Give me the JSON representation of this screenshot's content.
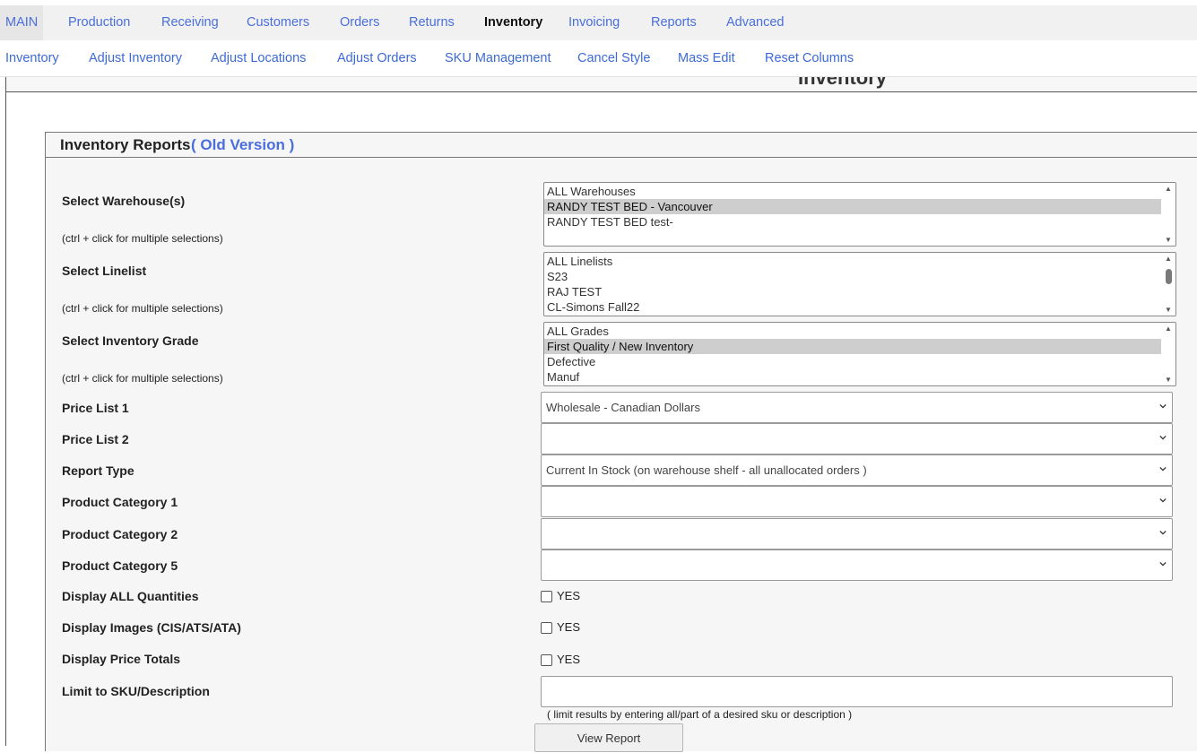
{
  "top_nav": {
    "items": [
      {
        "label": "MAIN"
      },
      {
        "label": "Production"
      },
      {
        "label": "Receiving"
      },
      {
        "label": "Customers"
      },
      {
        "label": "Orders"
      },
      {
        "label": "Returns"
      },
      {
        "label": "Inventory"
      },
      {
        "label": "Invoicing"
      },
      {
        "label": "Reports"
      },
      {
        "label": "Advanced"
      }
    ],
    "active": "Inventory"
  },
  "sub_nav": {
    "items": [
      {
        "label": "Inventory"
      },
      {
        "label": "Adjust Inventory"
      },
      {
        "label": "Adjust Locations"
      },
      {
        "label": "Adjust Orders"
      },
      {
        "label": "SKU Management"
      },
      {
        "label": "Cancel Style"
      },
      {
        "label": "Mass Edit"
      },
      {
        "label": "Reset Columns"
      }
    ]
  },
  "page": {
    "title": "Inventory"
  },
  "panel": {
    "title": "Inventory Reports",
    "link": "( Old Version )"
  },
  "form": {
    "warehouse": {
      "label": "Select Warehouse(s)",
      "hint": "(ctrl + click for multiple selections)",
      "options": [
        "ALL Warehouses",
        "RANDY TEST BED - Vancouver",
        "RANDY TEST BED test-"
      ],
      "selected": "RANDY TEST BED - Vancouver"
    },
    "linelist": {
      "label": "Select Linelist",
      "hint": "(ctrl + click for multiple selections)",
      "options": [
        "ALL Linelists",
        "S23",
        "RAJ TEST",
        "CL-Simons Fall22"
      ],
      "selected": ""
    },
    "grade": {
      "label": "Select Inventory Grade",
      "hint": "(ctrl + click for multiple selections)",
      "options": [
        "ALL Grades",
        "First Quality / New Inventory",
        "Defective",
        "Manuf"
      ],
      "selected": "First Quality / New Inventory"
    },
    "price_list_1": {
      "label": "Price List 1",
      "value": "Wholesale - Canadian Dollars"
    },
    "price_list_2": {
      "label": "Price List 2",
      "value": ""
    },
    "report_type": {
      "label": "Report Type",
      "value": "Current In Stock (on warehouse shelf - all unallocated orders )"
    },
    "category_1": {
      "label": "Product Category 1",
      "value": ""
    },
    "category_2": {
      "label": "Product Category 2",
      "value": ""
    },
    "category_5": {
      "label": "Product Category 5",
      "value": ""
    },
    "display_all": {
      "label": "Display ALL Quantities",
      "option": "YES",
      "checked": false
    },
    "display_images": {
      "label": "Display Images (CIS/ATS/ATA)",
      "option": "YES",
      "checked": false
    },
    "display_totals": {
      "label": "Display Price Totals",
      "option": "YES",
      "checked": false
    },
    "sku_limit": {
      "label": "Limit to SKU/Description",
      "value": "",
      "note": "( limit results by entering all/part of a desired sku or description )"
    },
    "submit_label": "View Report"
  }
}
